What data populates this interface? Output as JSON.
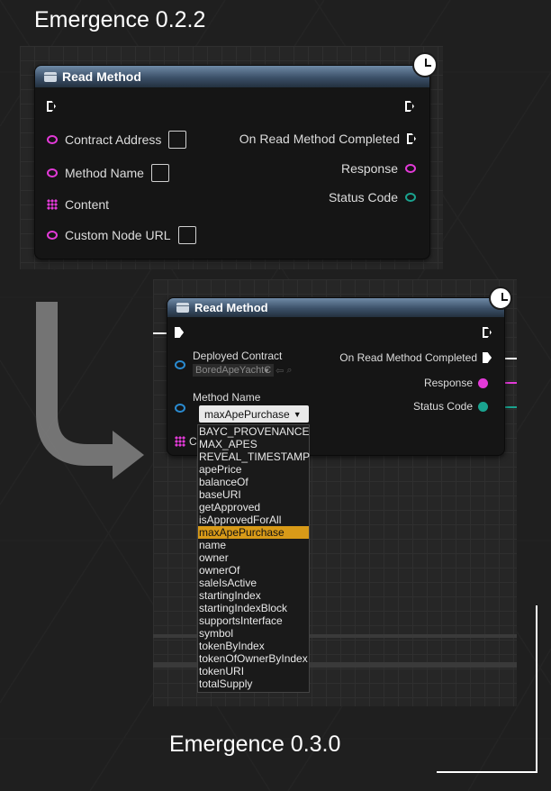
{
  "titles": {
    "top": "Emergence 0.2.2",
    "bottom": "Emergence 0.3.0"
  },
  "old_node": {
    "title": "Read Method",
    "inputs": [
      "Contract Address",
      "Method Name",
      "Content",
      "Custom Node URL"
    ],
    "outputs": [
      "On Read Method Completed",
      "Response",
      "Status Code"
    ]
  },
  "new_node": {
    "title": "Read Method",
    "deployed_contract_label": "Deployed Contract",
    "deployed_contract_value": "BoredApeYachtC",
    "method_name_label": "Method Name",
    "method_name_value": "maxApePurchase",
    "content_partial": "C",
    "outputs": [
      "On Read Method Completed",
      "Response",
      "Status Code"
    ]
  },
  "dropdown": {
    "options": [
      "BAYC_PROVENANCE",
      "MAX_APES",
      "REVEAL_TIMESTAMP",
      "apePrice",
      "balanceOf",
      "baseURI",
      "getApproved",
      "isApprovedForAll",
      "maxApePurchase",
      "name",
      "owner",
      "ownerOf",
      "saleIsActive",
      "startingIndex",
      "startingIndexBlock",
      "supportsInterface",
      "symbol",
      "tokenByIndex",
      "tokenOfOwnerByIndex",
      "tokenURI",
      "totalSupply"
    ],
    "selected": "maxApePurchase"
  },
  "icons": {
    "clock": "clock-icon",
    "arrow": "curved-arrow-icon",
    "exec": "exec-pin-icon"
  },
  "colors": {
    "pin_pink": "#e33ad8",
    "pin_teal": "#1aa38f",
    "pin_blue": "#2a8bd1",
    "selected_highlight": "#d89a18"
  }
}
